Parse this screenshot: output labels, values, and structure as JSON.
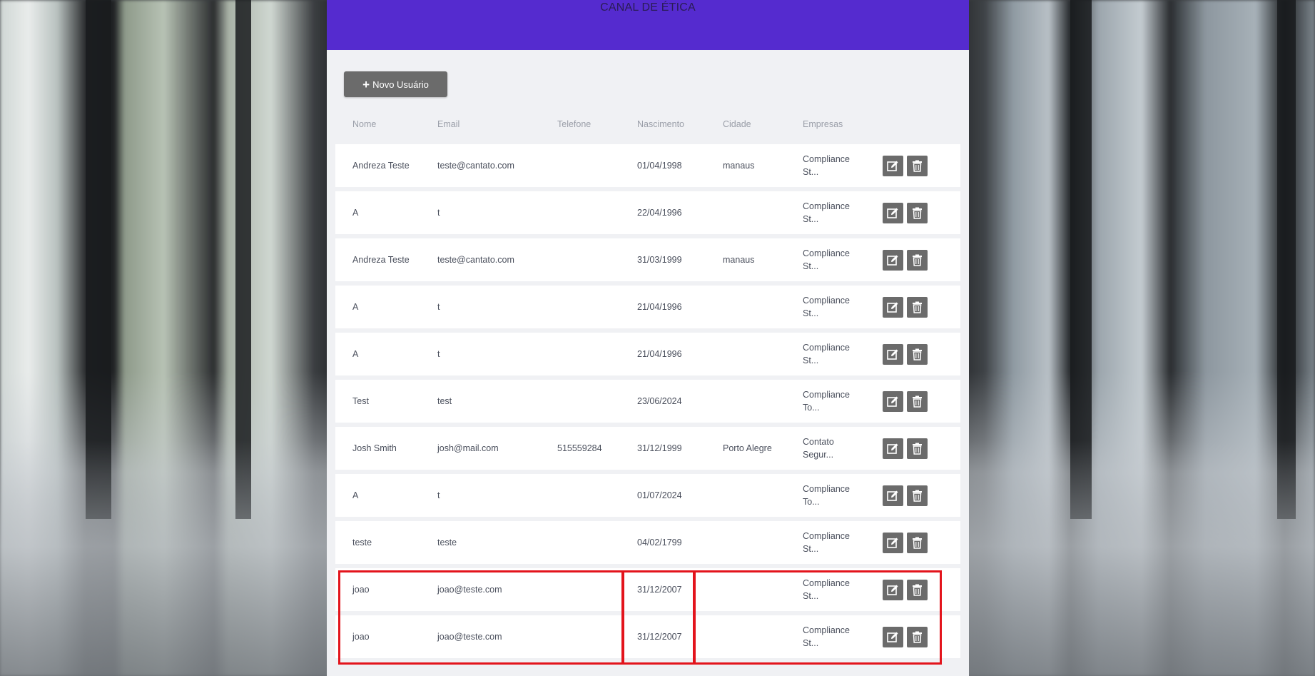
{
  "header": {
    "title": "CANAL DE ÉTICA"
  },
  "toolbar": {
    "new_user_label": "Novo Usuário",
    "new_user_icon": "plus-icon"
  },
  "table": {
    "columns": [
      "Nome",
      "Email",
      "Telefone",
      "Nascimento",
      "Cidade",
      "Empresas"
    ],
    "rows": [
      {
        "nome": "Andreza Teste",
        "email": "teste@cantato.com",
        "telefone": "",
        "nascimento": "01/04/1998",
        "cidade": "manaus",
        "empresas": "Compliance St..."
      },
      {
        "nome": "A",
        "email": "t",
        "telefone": "",
        "nascimento": "22/04/1996",
        "cidade": "",
        "empresas": "Compliance St..."
      },
      {
        "nome": "Andreza Teste",
        "email": "teste@cantato.com",
        "telefone": "",
        "nascimento": "31/03/1999",
        "cidade": "manaus",
        "empresas": "Compliance St..."
      },
      {
        "nome": "A",
        "email": "t",
        "telefone": "",
        "nascimento": "21/04/1996",
        "cidade": "",
        "empresas": "Compliance St..."
      },
      {
        "nome": "A",
        "email": "t",
        "telefone": "",
        "nascimento": "21/04/1996",
        "cidade": "",
        "empresas": "Compliance St..."
      },
      {
        "nome": "Test",
        "email": "test",
        "telefone": "",
        "nascimento": "23/06/2024",
        "cidade": "",
        "empresas": "Compliance To..."
      },
      {
        "nome": "Josh Smith",
        "email": "josh@mail.com",
        "telefone": "515559284",
        "nascimento": "31/12/1999",
        "cidade": "Porto Alegre",
        "empresas": "Contato Segur..."
      },
      {
        "nome": "A",
        "email": "t",
        "telefone": "",
        "nascimento": "01/07/2024",
        "cidade": "",
        "empresas": "Compliance To..."
      },
      {
        "nome": "teste",
        "email": "teste",
        "telefone": "",
        "nascimento": "04/02/1799",
        "cidade": "",
        "empresas": "Compliance St..."
      },
      {
        "nome": "joao",
        "email": "joao@teste.com",
        "telefone": "",
        "nascimento": "31/12/2007",
        "cidade": "",
        "empresas": "Compliance St..."
      },
      {
        "nome": "joao",
        "email": "joao@teste.com",
        "telefone": "",
        "nascimento": "31/12/2007",
        "cidade": "",
        "empresas": "Compliance St..."
      }
    ],
    "row_action_icons": [
      "edit-icon",
      "trash-icon"
    ]
  },
  "colors": {
    "header_bg": "#552bcf",
    "panel_bg": "#f0f1f4",
    "button_bg": "#6b6b6b",
    "highlight": "#e3141c"
  }
}
